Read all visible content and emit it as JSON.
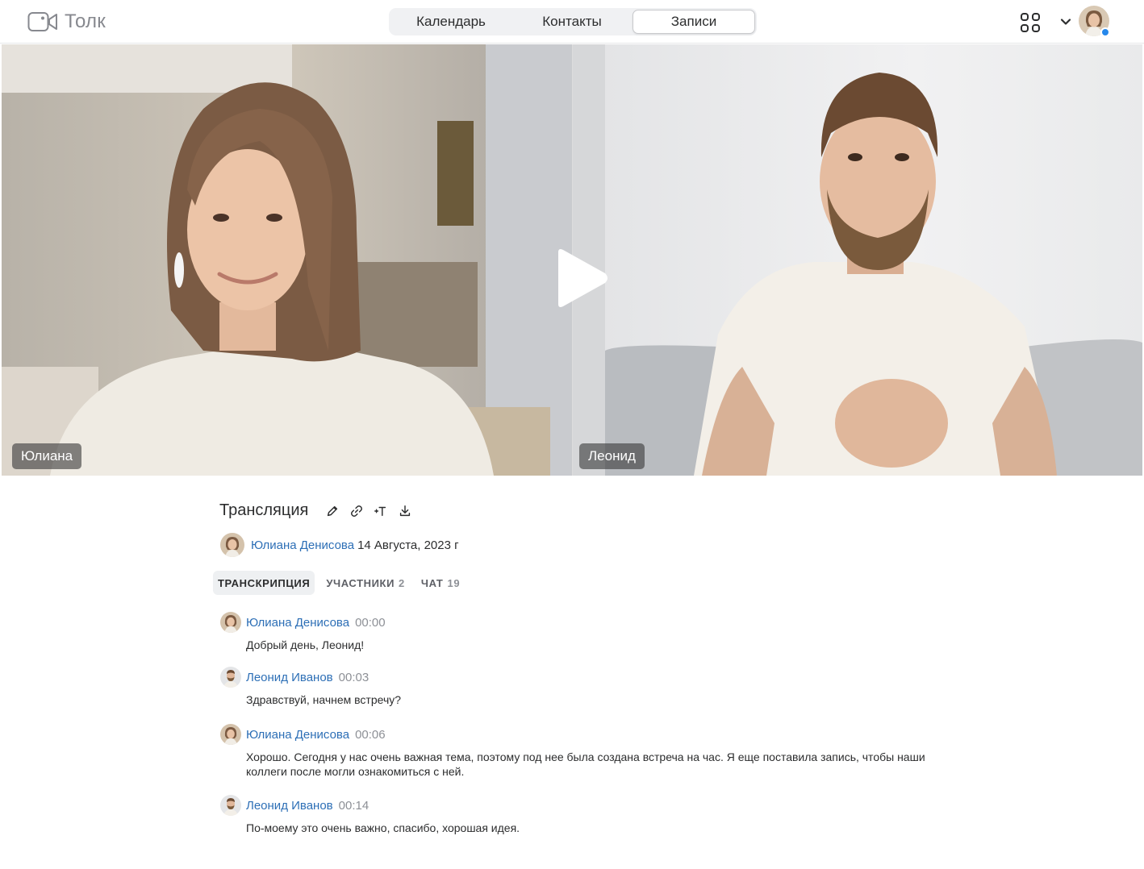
{
  "app": {
    "name": "Толк"
  },
  "nav": {
    "tabs": [
      {
        "label": "Календарь",
        "active": false
      },
      {
        "label": "Контакты",
        "active": false
      },
      {
        "label": "Записи",
        "active": true
      }
    ]
  },
  "header": {
    "apps_icon": "grid-icon",
    "menu_icon": "chevron-down-icon",
    "status_color": "#2688eb"
  },
  "video": {
    "participants": [
      {
        "name": "Юлиана"
      },
      {
        "name": "Леонид"
      }
    ],
    "play_icon": "play-icon"
  },
  "recording": {
    "title": "Трансляция",
    "tools": [
      "edit-icon",
      "link-icon",
      "text-size-icon",
      "download-icon"
    ],
    "author": "Юлиана Денисова",
    "date": "14 Августа, 2023 г"
  },
  "tabs": [
    {
      "label": "ТРАНСКРИПЦИЯ",
      "count": "",
      "active": true
    },
    {
      "label": "УЧАСТНИКИ",
      "count": "2",
      "active": false
    },
    {
      "label": "ЧАТ",
      "count": "19",
      "active": false
    }
  ],
  "transcript": [
    {
      "name": "Юлиана Денисова",
      "time": "00:00",
      "text": "Добрый день, Леонид!"
    },
    {
      "name": "Леонид Иванов",
      "time": "00:03",
      "text": "Здравствуй, начнем встречу?"
    },
    {
      "name": "Юлиана Денисова",
      "time": "00:06",
      "text": "Хорошо. Сегодня у нас очень важная тема, поэтому под нее была создана встреча на час. Я еще поставила запись, чтобы наши коллеги после могли ознакомиться с ней."
    },
    {
      "name": "Леонид Иванов",
      "time": "00:14",
      "text": "По-моему это очень важно, спасибо, хорошая идея."
    }
  ],
  "colors": {
    "link": "#2d6fb6",
    "accent": "#2688eb"
  }
}
